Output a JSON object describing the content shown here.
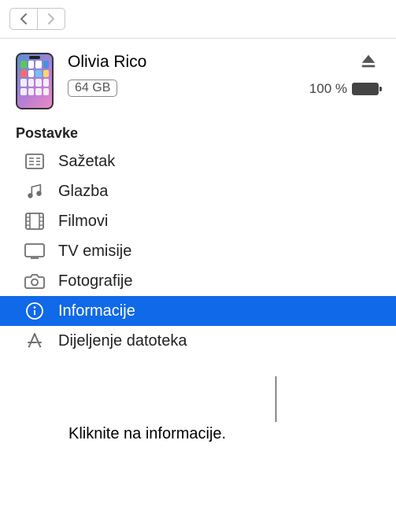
{
  "device": {
    "name": "Olivia Rico",
    "storage": "64 GB",
    "battery_percent": "100 %"
  },
  "section_header": "Postavke",
  "sidebar": {
    "items": [
      {
        "label": "Sažetak",
        "icon": "summary",
        "selected": false
      },
      {
        "label": "Glazba",
        "icon": "music",
        "selected": false
      },
      {
        "label": "Filmovi",
        "icon": "film",
        "selected": false
      },
      {
        "label": "TV emisije",
        "icon": "tv",
        "selected": false
      },
      {
        "label": "Fotografije",
        "icon": "camera",
        "selected": false
      },
      {
        "label": "Informacije",
        "icon": "info",
        "selected": true
      },
      {
        "label": "Dijeljenje datoteka",
        "icon": "appstore",
        "selected": false
      }
    ]
  },
  "callout": "Kliknite na informacije."
}
